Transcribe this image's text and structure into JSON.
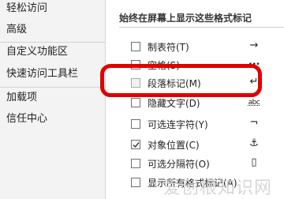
{
  "sidebar": {
    "items": [
      {
        "label": "轻松访问"
      },
      {
        "label": "高级"
      },
      {
        "label": "自定义功能区"
      },
      {
        "label": "快速访问工具栏"
      },
      {
        "label": "加载项"
      },
      {
        "label": "信任中心"
      }
    ]
  },
  "panel": {
    "title": "始终在屏幕上显示这些格式标记",
    "rows": [
      {
        "label": "制表符(T)",
        "symbol": "→",
        "checked": false
      },
      {
        "label": "空格(S)",
        "symbol": "•••",
        "checked": false
      },
      {
        "label": "段落标记(M)",
        "symbol": "↵",
        "checked": false
      },
      {
        "label": "隐藏文字(D)",
        "symbol": "abc",
        "checked": false
      },
      {
        "label": "可选连字符(Y)",
        "symbol": "¬",
        "checked": false
      },
      {
        "label": "对象位置(C)",
        "symbol": "⚓",
        "checked": true
      },
      {
        "label": "可选分隔符(O)",
        "symbol": "▯",
        "checked": false
      },
      {
        "label": "显示所有格式标记(A)",
        "symbol": "",
        "checked": false
      }
    ]
  },
  "watermark": "爱创根知识网",
  "colors": {
    "highlight": "#e00000",
    "sidebar_bg": "#f3f3f3"
  }
}
